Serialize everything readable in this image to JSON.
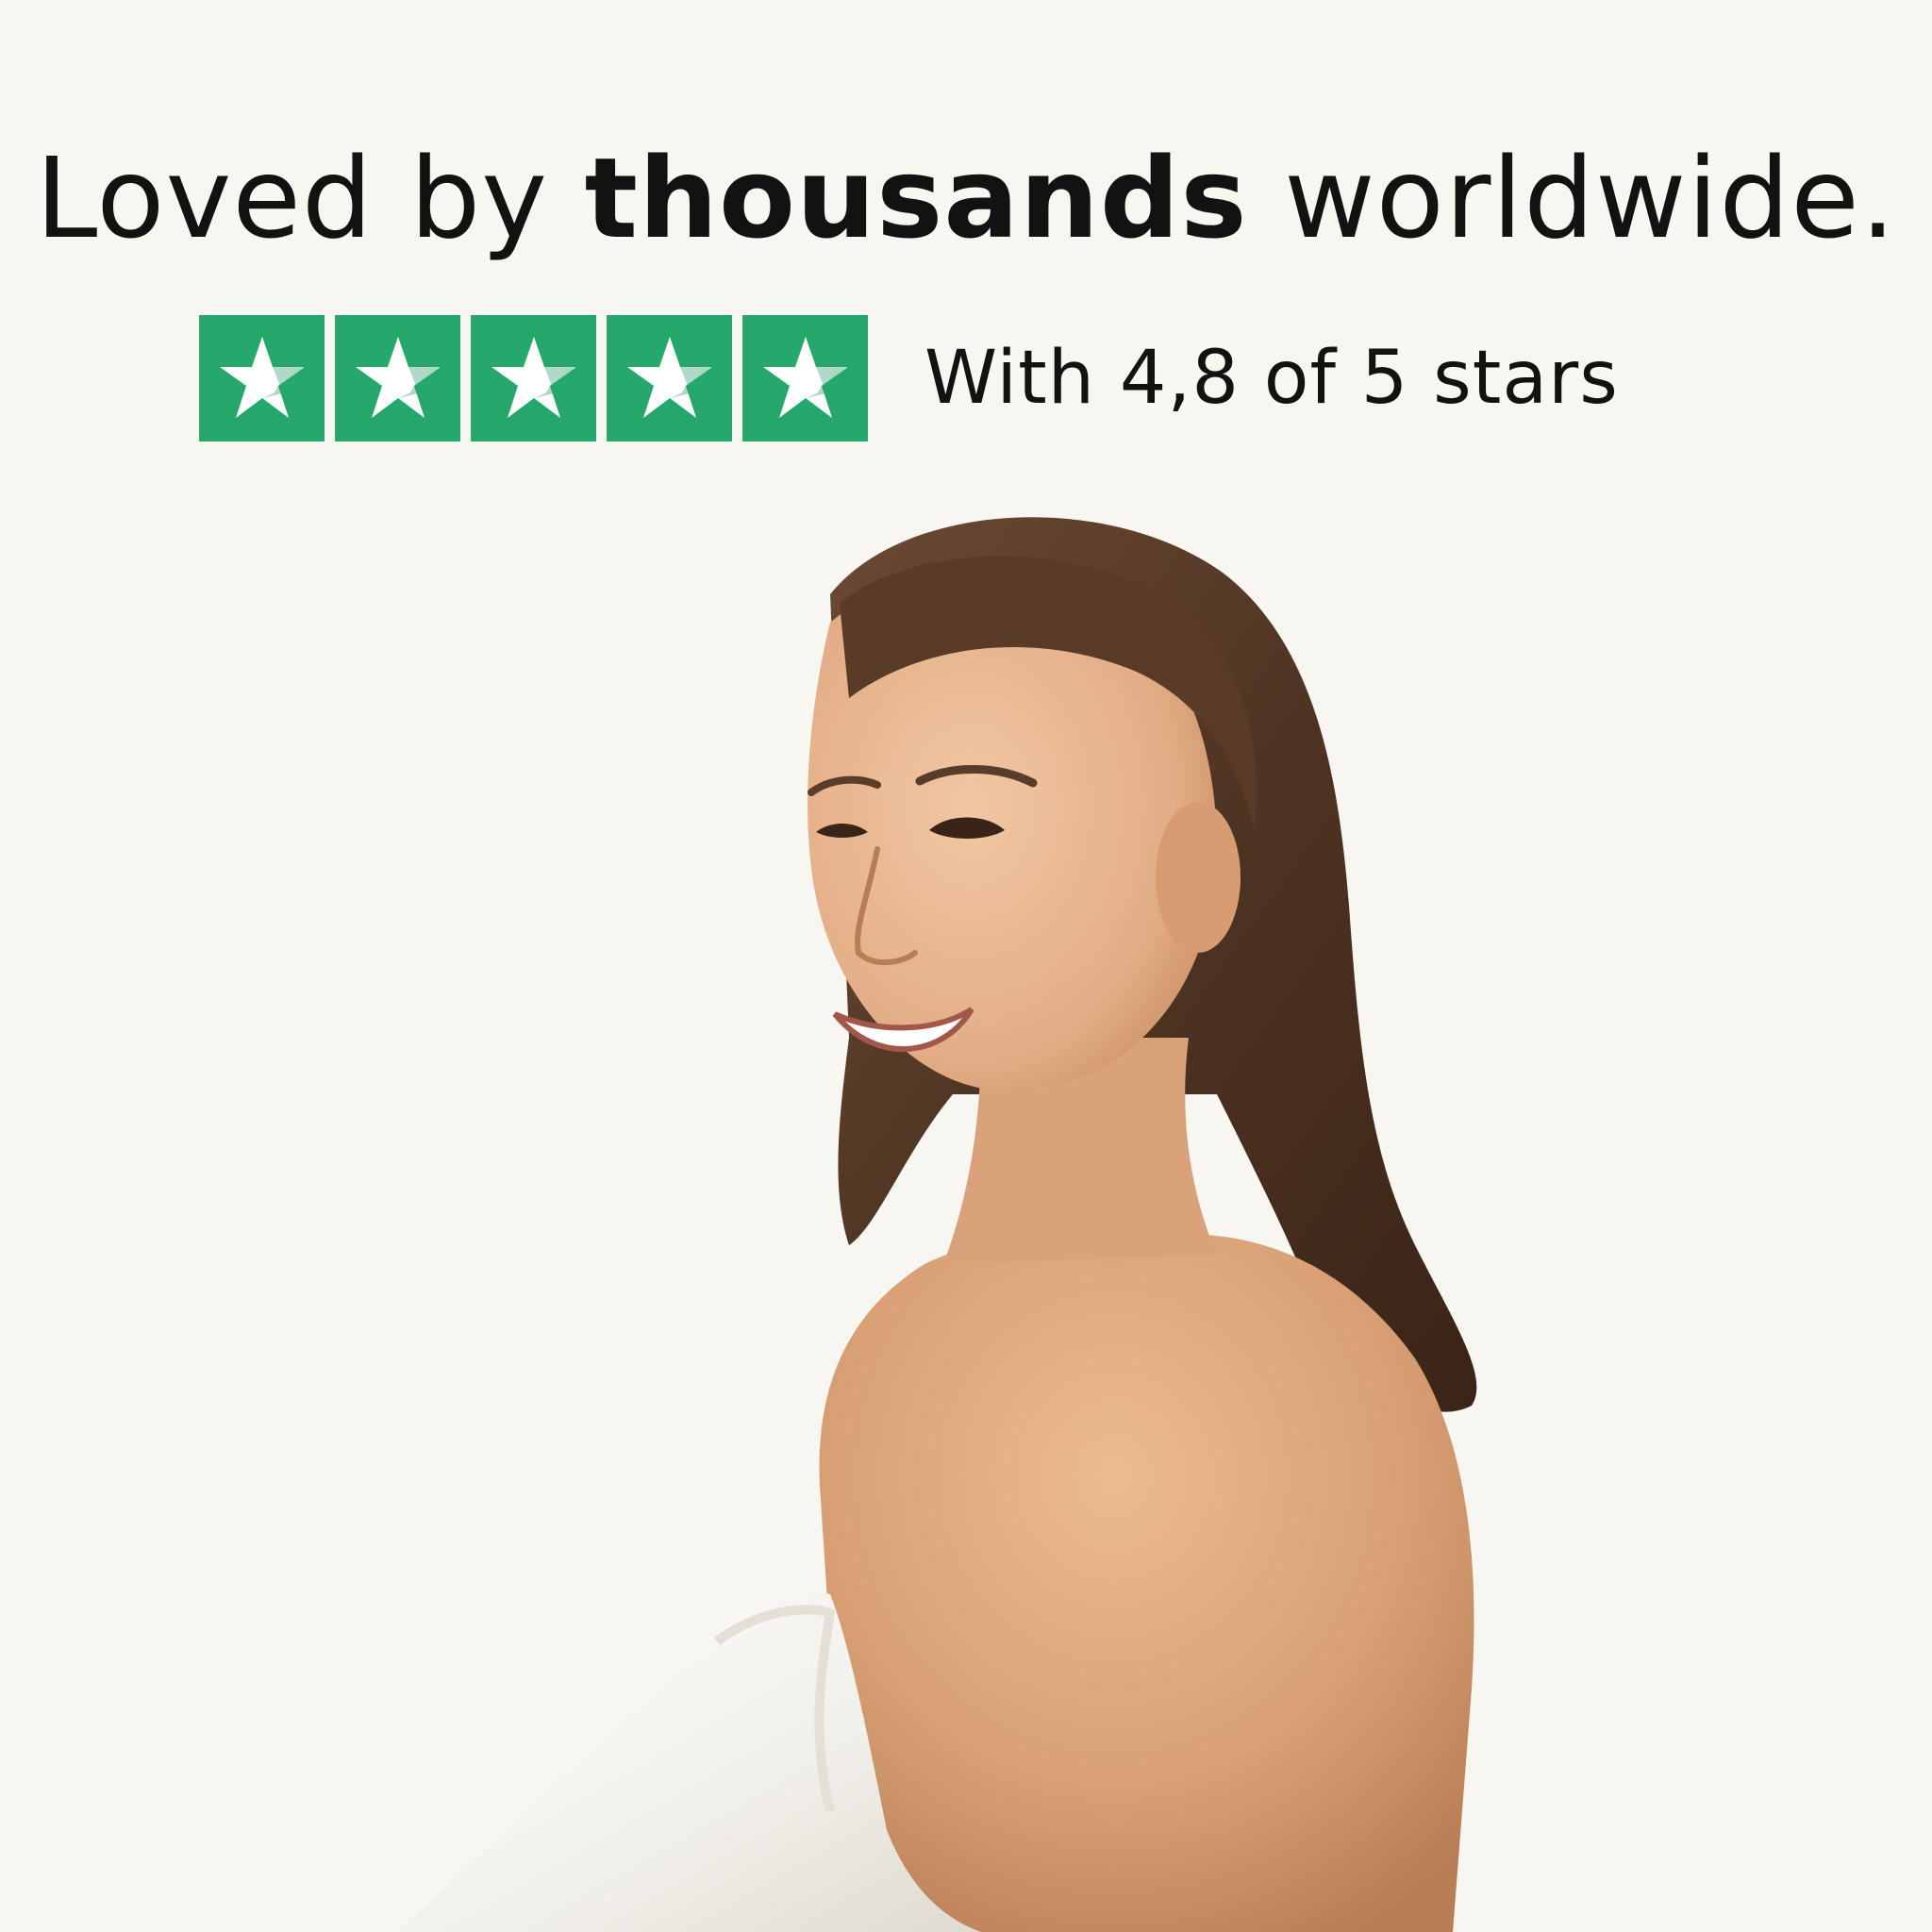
{
  "headline": {
    "before": "Loved by ",
    "bold": "thousands",
    "after": " worldwide."
  },
  "rating": {
    "stars_filled": 5,
    "stars_total": 5,
    "text": "With 4,8 of 5 stars",
    "star_icon": "star-icon"
  },
  "colors": {
    "background": "#f8f6f1",
    "accent": "#26a86c",
    "text": "#121212"
  }
}
